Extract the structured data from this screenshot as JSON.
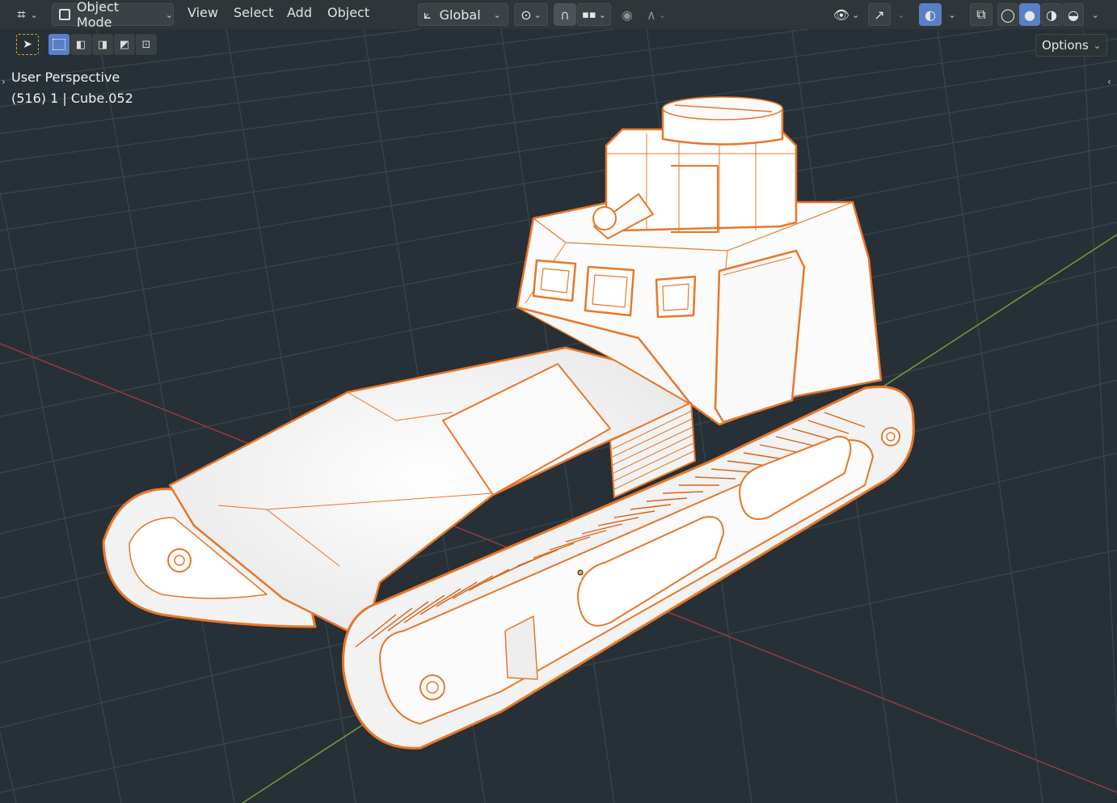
{
  "header": {
    "editor_icon": "editor-type-icon",
    "mode_label": "Object Mode",
    "menus": [
      "View",
      "Select",
      "Add",
      "Object"
    ],
    "transform_orientation": "Global",
    "options_label": "Options"
  },
  "viewport": {
    "perspective_label": "User Perspective",
    "object_info": "(516) 1 | Cube.052"
  },
  "colors": {
    "background": "#263036",
    "grid": "#3a4448",
    "x_axis": "#8b3a3f",
    "y_axis": "#6a9a3a",
    "selection_outline": "#e8772a",
    "mesh_fill": "#f4f4f4",
    "active_button": "#5a7fc7"
  }
}
